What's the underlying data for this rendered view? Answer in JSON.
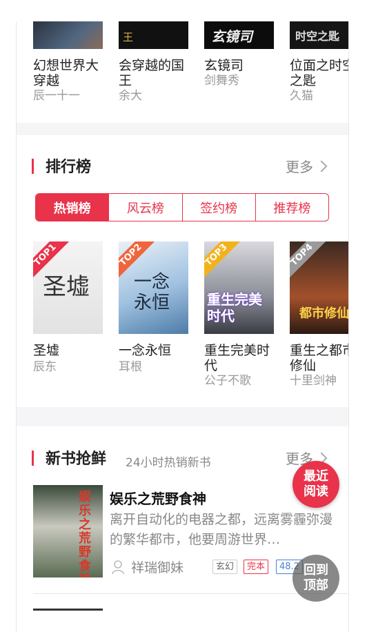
{
  "top_books": [
    {
      "title": "幻想世界大穿越",
      "author": "辰一十一",
      "cover_text": ""
    },
    {
      "title": "会穿越的国王",
      "author": "余大",
      "cover_text": "王"
    },
    {
      "title": "玄镜司",
      "author": "剑舞秀",
      "cover_text": "玄镜司"
    },
    {
      "title": "位面之时空之匙",
      "author": "久猫",
      "cover_text": "时空之匙"
    }
  ],
  "ranking": {
    "title": "排行榜",
    "more_label": "更多",
    "tabs": [
      "热销榜",
      "风云榜",
      "签约榜",
      "推荐榜"
    ],
    "active_tab": 0,
    "books": [
      {
        "rank": "TOP1",
        "title": "圣墟",
        "author": "辰东",
        "badge_color": "#e8334a",
        "cover_text": "圣墟"
      },
      {
        "rank": "TOP2",
        "title": "一念永恒",
        "author": "耳根",
        "badge_color": "#f0653c",
        "cover_text": "一念永恒"
      },
      {
        "rank": "TOP3",
        "title": "重生完美时代",
        "author": "公子不歌",
        "badge_color": "#f2b21c",
        "cover_text": "重生完美时代"
      },
      {
        "rank": "TOP4",
        "title": "重生之都市修仙",
        "author": "十里剑神",
        "badge_color": "#9a9a9a",
        "cover_text": "都市修仙"
      }
    ]
  },
  "new_books": {
    "title": "新书抢鲜",
    "subtitle": "24小时热销新书",
    "more_label": "更多",
    "item": {
      "title": "娱乐之荒野食神",
      "description": "离开自动化的电器之都，远离雾霾弥漫的繁华都市，他要周游世界…",
      "author": "祥瑞御妹",
      "tags": [
        "玄幻",
        "完本",
        "48.2"
      ],
      "cover_text": "娱乐之荒野食神"
    }
  },
  "floating": {
    "recent_read": "最近阅读",
    "back_to_top": "回到顶部"
  }
}
